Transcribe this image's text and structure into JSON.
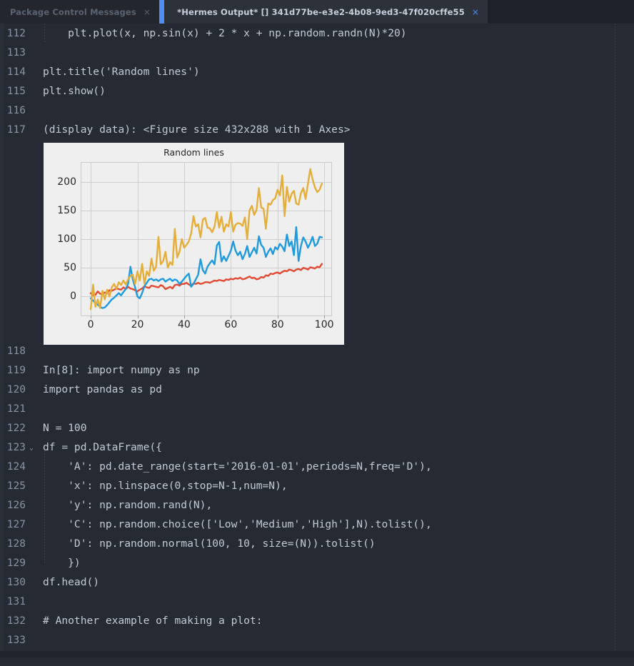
{
  "window": {
    "app": "Sublime Text",
    "colors": {
      "tabbar_bg": "#1e2127",
      "tab_active_bg": "#2d313a",
      "tab_inactive_bg": "#23262d",
      "editor_bg": "#262a33",
      "accent": "#4f8ef7",
      "linenumber": "#8a93a3",
      "code_text": "#c3cad6"
    }
  },
  "tabs": [
    {
      "label": "Package Control Messages",
      "close_label": "×",
      "active": false
    },
    {
      "label": "*Hermes Output* [] 341d77be-e3e2-4b08-9ed3-47f020cffe55",
      "close_label": "×",
      "active": true
    }
  ],
  "editor": {
    "fold_marker": "⌄",
    "lines": [
      {
        "no": "112",
        "text": "    plt.plot(x, np.sin(x) + 2 * x + np.random.randn(N)*20)",
        "fold": false
      },
      {
        "no": "113",
        "text": "",
        "fold": false
      },
      {
        "no": "114",
        "text": "plt.title('Random lines')",
        "fold": false
      },
      {
        "no": "115",
        "text": "plt.show()",
        "fold": false
      },
      {
        "no": "116",
        "text": "",
        "fold": false
      },
      {
        "no": "117",
        "text": "(display data): <Figure size 432x288 with 1 Axes>",
        "fold": false
      },
      {
        "no": "",
        "text": "",
        "fold": false,
        "spacer": true
      },
      {
        "no": "118",
        "text": "",
        "fold": false
      },
      {
        "no": "119",
        "text": "In[8]: import numpy as np",
        "fold": false
      },
      {
        "no": "120",
        "text": "import pandas as pd",
        "fold": false
      },
      {
        "no": "121",
        "text": "",
        "fold": false
      },
      {
        "no": "122",
        "text": "N = 100",
        "fold": false
      },
      {
        "no": "123",
        "text": "df = pd.DataFrame({",
        "fold": true
      },
      {
        "no": "124",
        "text": "    'A': pd.date_range(start='2016-01-01',periods=N,freq='D'),",
        "fold": false
      },
      {
        "no": "125",
        "text": "    'x': np.linspace(0,stop=N-1,num=N),",
        "fold": false
      },
      {
        "no": "126",
        "text": "    'y': np.random.rand(N),",
        "fold": false
      },
      {
        "no": "127",
        "text": "    'C': np.random.choice(['Low','Medium','High'],N).tolist(),",
        "fold": false
      },
      {
        "no": "128",
        "text": "    'D': np.random.normal(100, 10, size=(N)).tolist()",
        "fold": false
      },
      {
        "no": "129",
        "text": "    })",
        "fold": false
      },
      {
        "no": "130",
        "text": "df.head()",
        "fold": false
      },
      {
        "no": "131",
        "text": "",
        "fold": false
      },
      {
        "no": "132",
        "text": "# Another example of making a plot:",
        "fold": false
      },
      {
        "no": "133",
        "text": "",
        "fold": false
      }
    ]
  },
  "chart_data": {
    "type": "line",
    "title": "Random lines",
    "xlabel": "",
    "ylabel": "",
    "xlim": [
      -4,
      103
    ],
    "ylim": [
      -33,
      233
    ],
    "xticks": [
      0,
      20,
      40,
      60,
      80,
      100
    ],
    "yticks": [
      0,
      50,
      100,
      150,
      200
    ],
    "xtick_labels": [
      "0",
      "20",
      "40",
      "60",
      "80",
      "100"
    ],
    "ytick_labels": [
      "0",
      "50",
      "100",
      "150",
      "200"
    ],
    "grid": true,
    "legend": "none",
    "figure_bg": "#efefef",
    "axes_bg": "#efefef",
    "grid_color": "#cfcfcf",
    "x": [
      0,
      1,
      2,
      3,
      4,
      5,
      6,
      7,
      8,
      9,
      10,
      11,
      12,
      13,
      14,
      15,
      16,
      17,
      18,
      19,
      20,
      21,
      22,
      23,
      24,
      25,
      26,
      27,
      28,
      29,
      30,
      31,
      32,
      33,
      34,
      35,
      36,
      37,
      38,
      39,
      40,
      41,
      42,
      43,
      44,
      45,
      46,
      47,
      48,
      49,
      50,
      51,
      52,
      53,
      54,
      55,
      56,
      57,
      58,
      59,
      60,
      61,
      62,
      63,
      64,
      65,
      66,
      67,
      68,
      69,
      70,
      71,
      72,
      73,
      74,
      75,
      76,
      77,
      78,
      79,
      80,
      81,
      82,
      83,
      84,
      85,
      86,
      87,
      88,
      89,
      90,
      91,
      92,
      93,
      94,
      95,
      96,
      97,
      98,
      99
    ],
    "series": [
      {
        "name": "line-red",
        "color": "#e24a33",
        "values": [
          6,
          2,
          3,
          9,
          5,
          4,
          7,
          6,
          11,
          10,
          12,
          14,
          13,
          12,
          16,
          13,
          17,
          14,
          13,
          11,
          9,
          12,
          14,
          18,
          16,
          15,
          19,
          18,
          17,
          16,
          20,
          18,
          13,
          15,
          17,
          14,
          20,
          21,
          19,
          22,
          22,
          24,
          21,
          19,
          23,
          22,
          24,
          22,
          23,
          25,
          25,
          24,
          26,
          28,
          27,
          29,
          28,
          27,
          30,
          29,
          31,
          30,
          32,
          31,
          33,
          30,
          31,
          33,
          35,
          32,
          33,
          30,
          31,
          34,
          33,
          37,
          36,
          40,
          39,
          41,
          42,
          40,
          43,
          45,
          44,
          47,
          46,
          44,
          47,
          48,
          46,
          50,
          49,
          47,
          51,
          50,
          49,
          52,
          51,
          57
        ]
      },
      {
        "name": "line-blue",
        "color": "#1f9ade",
        "values": [
          -3,
          -7,
          -11,
          -14,
          -18,
          -20,
          -19,
          -15,
          -10,
          -5,
          -2,
          2,
          6,
          2,
          8,
          13,
          22,
          52,
          30,
          16,
          0,
          -3,
          6,
          18,
          24,
          30,
          31,
          28,
          30,
          27,
          30,
          31,
          26,
          29,
          31,
          27,
          30,
          28,
          22,
          26,
          31,
          36,
          40,
          17,
          22,
          30,
          38,
          65,
          46,
          40,
          52,
          58,
          63,
          56,
          89,
          95,
          61,
          70,
          62,
          71,
          80,
          96,
          80,
          72,
          78,
          65,
          74,
          88,
          69,
          77,
          85,
          75,
          105,
          90,
          85,
          69,
          78,
          84,
          74,
          86,
          82,
          92,
          87,
          79,
          108,
          88,
          96,
          72,
          121,
          62,
          88,
          103,
          96,
          85,
          93,
          104,
          88,
          92,
          104,
          103
        ]
      },
      {
        "name": "line-gold",
        "color": "#e5ae38",
        "values": [
          -22,
          21,
          -18,
          -5,
          -20,
          10,
          -5,
          12,
          0,
          16,
          22,
          13,
          25,
          20,
          28,
          21,
          30,
          36,
          38,
          22,
          44,
          28,
          57,
          22,
          44,
          36,
          66,
          45,
          52,
          104,
          56,
          62,
          78,
          50,
          60,
          55,
          118,
          68,
          78,
          100,
          85,
          90,
          96,
          110,
          140,
          122,
          126,
          103,
          134,
          137,
          120,
          119,
          112,
          122,
          147,
          120,
          139,
          113,
          126,
          122,
          147,
          113,
          125,
          128,
          127,
          123,
          138,
          100,
          150,
          158,
          142,
          151,
          189,
          155,
          153,
          118,
          162,
          160,
          168,
          171,
          186,
          176,
          211,
          140,
          191,
          165,
          179,
          184,
          162,
          160,
          180,
          189,
          170,
          196,
          222,
          204,
          190,
          182,
          186,
          197
        ]
      }
    ]
  }
}
